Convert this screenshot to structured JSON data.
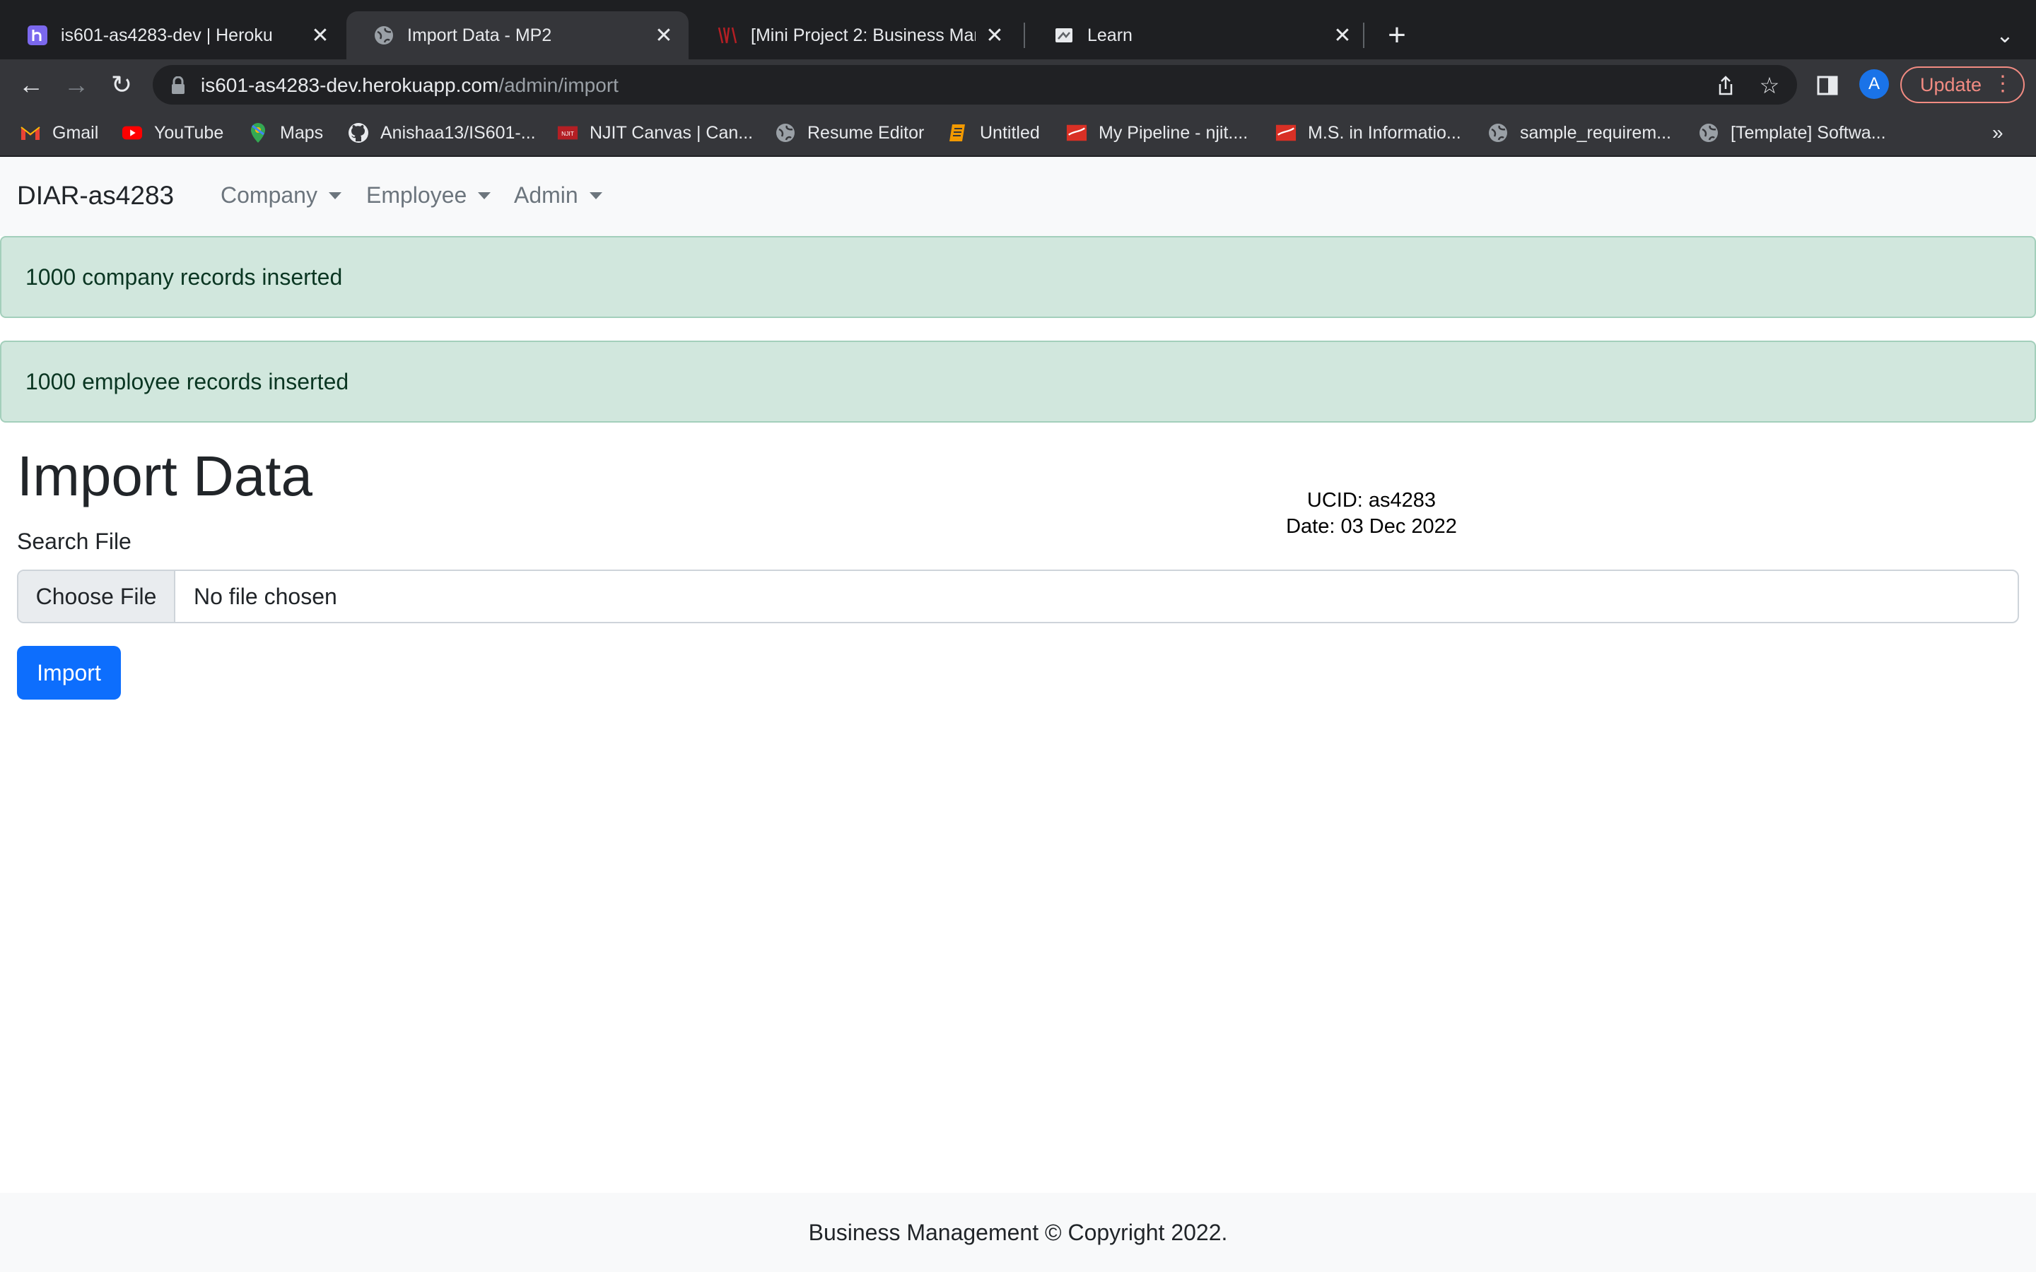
{
  "browser": {
    "tabs": [
      {
        "title": "is601-as4283-dev | Heroku",
        "icon": "heroku-icon",
        "active": false
      },
      {
        "title": "Import Data - MP2",
        "icon": "globe-icon",
        "active": true
      },
      {
        "title": "[Mini Project 2: Business Mana",
        "icon": "njit-icon",
        "active": false
      },
      {
        "title": "Learn",
        "icon": "learn-icon",
        "active": false
      }
    ],
    "url_host": "is601-as4283-dev.herokuapp.com",
    "url_path": "/admin/import",
    "profile_initial": "A",
    "update_label": "Update",
    "bookmarks": [
      {
        "label": "Gmail",
        "icon": "gmail-icon"
      },
      {
        "label": "YouTube",
        "icon": "youtube-icon"
      },
      {
        "label": "Maps",
        "icon": "maps-icon"
      },
      {
        "label": "Anishaa13/IS601-...",
        "icon": "github-icon"
      },
      {
        "label": "NJIT Canvas | Can...",
        "icon": "njit-icon"
      },
      {
        "label": "Resume Editor",
        "icon": "globe-icon"
      },
      {
        "label": "Untitled",
        "icon": "notebook-icon"
      },
      {
        "label": "My Pipeline - njit....",
        "icon": "flag-icon"
      },
      {
        "label": "M.S. in Informatio...",
        "icon": "flag-icon"
      },
      {
        "label": "sample_requirem...",
        "icon": "globe-icon"
      },
      {
        "label": "[Template] Softwa...",
        "icon": "globe-icon"
      }
    ],
    "bookmarks_more": "»"
  },
  "page": {
    "brand": "DIAR-as4283",
    "nav": [
      "Company",
      "Employee",
      "Admin"
    ],
    "alerts": [
      "1000 company records inserted",
      "1000 employee records inserted"
    ],
    "heading": "Import Data",
    "ucid": "UCID: as4283",
    "date": "Date: 03 Dec 2022",
    "search_label": "Search File",
    "choose_file": "Choose File",
    "no_file": "No file chosen",
    "import_button": "Import",
    "footer": "Business Management © Copyright 2022."
  },
  "colors": {
    "alert_bg": "#d1e7dd",
    "alert_text": "#0a3622",
    "primary": "#0d6efd",
    "update_accent": "#f28b82"
  }
}
